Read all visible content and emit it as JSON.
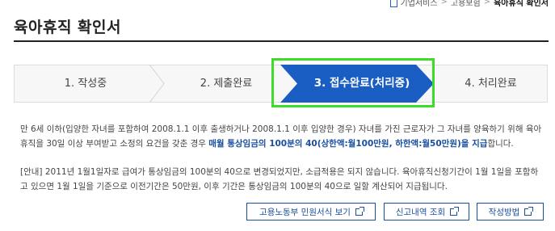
{
  "breadcrumb": {
    "items": [
      "기업서비스",
      "고용보험",
      "육아휴직 확인서"
    ]
  },
  "page": {
    "title": "육아휴직 확인서"
  },
  "steps": [
    {
      "label": "1. 작성중",
      "active": false
    },
    {
      "label": "2. 제출완료",
      "active": false
    },
    {
      "label": "3. 접수완료(처리중)",
      "active": true
    },
    {
      "label": "4. 처리완료",
      "active": false
    }
  ],
  "notice": {
    "p1_text": "만 6세 이하(입양한 자녀를 포함하여 2008.1.1 이후 출생하거나 2008.1.1 이후 입양한 경우) 자녀를 가진 근로자가 그 자녀를 양육하기 위해 육아휴직을 30일 이상 부여받고 소정의 요건을 갖춘 경우 ",
    "p1_highlight": "매월 통상임금의 100분의 40(상한액:월100만원, 하한액:월50만원)을 지급",
    "p1_tail": "합니다.",
    "p2_text": "[안내] 2011년 1월1일자로 급여가 통상임금의 100분의 40으로 변경되었지만, 소급적용은 되지 않습니다. 육아휴직신청기간이 1월 1일을 포함하고 있으면 1월 1일을 기준으로 이전기간은 50만원, 이후 기간은 통상임금의 100분의 40으로 일할 계산되어 지급됩니다."
  },
  "buttons": {
    "forms_label": "고용노동부 민원서식 보기",
    "history_label": "신고내역 조회",
    "howto_label": "작성방법"
  },
  "colors": {
    "active_step": "#1a5ec4",
    "highlight_box": "#3ddc2b",
    "link_blue": "#1a4fa0"
  }
}
